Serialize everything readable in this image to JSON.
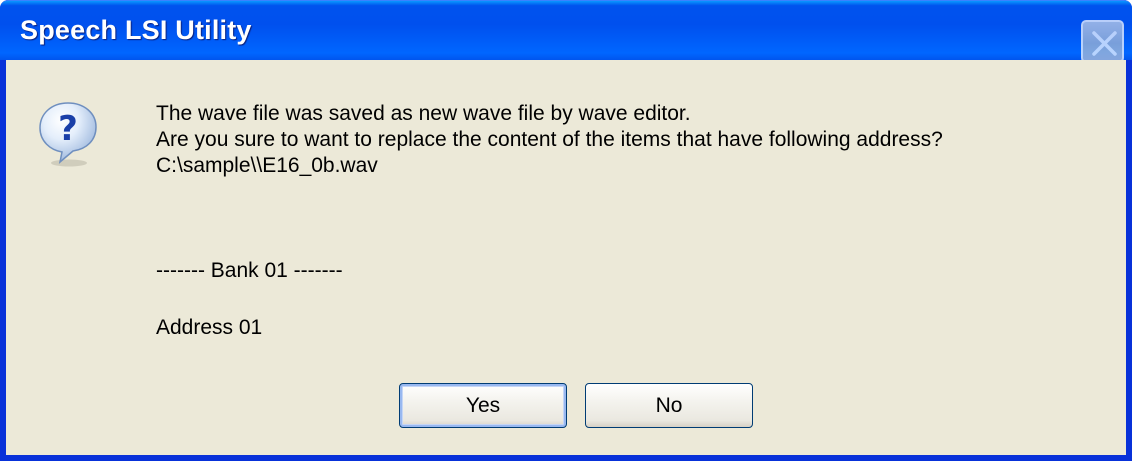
{
  "window": {
    "title": "Speech LSI Utility",
    "close_icon": "close-icon"
  },
  "dialog": {
    "icon": "question-icon",
    "message_line1": "The wave file was saved as new wave file by wave editor.",
    "message_line2": "Are you sure to want to replace the content of the items that have following address?",
    "file_path": "C:\\sample\\\\E16_0b.wav",
    "bank_header": "------- Bank 01 -------",
    "address": "Address 01"
  },
  "buttons": {
    "yes_label": "Yes",
    "no_label": "No"
  },
  "colors": {
    "titlebar": "#0054e3",
    "client_background": "#ece9d8",
    "button_focus": "#98b8f0"
  }
}
